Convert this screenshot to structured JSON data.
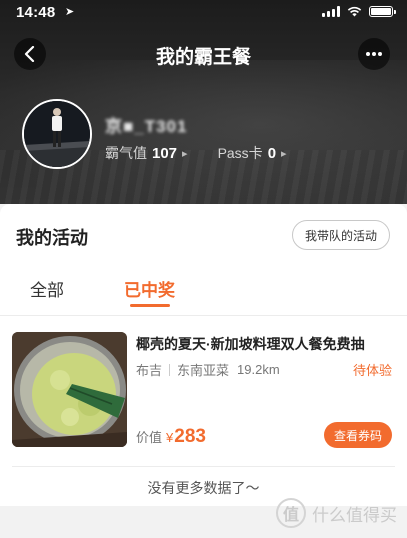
{
  "status_bar": {
    "time": "14:48",
    "location_glyph": "➤"
  },
  "nav": {
    "title": "我的霸王餐",
    "back_icon": "chevron-left-icon",
    "more_icon": "more-dots-icon"
  },
  "profile": {
    "username": "京■_T301",
    "stats": [
      {
        "label": "霸气值",
        "value": "107"
      },
      {
        "label": "Pass卡",
        "value": "0"
      }
    ]
  },
  "activities": {
    "title": "我的活动",
    "team_button": "我带队的活动",
    "tabs": [
      {
        "label": "全部",
        "active": false
      },
      {
        "label": "已中奖",
        "active": true
      }
    ],
    "items": [
      {
        "title": "椰壳的夏天·新加坡料理双人餐免费抽",
        "area": "布吉",
        "cuisine": "东南亚菜",
        "distance": "19.2km",
        "status": "待体验",
        "price_label": "价值",
        "currency": "¥",
        "price": "283",
        "action": "查看券码"
      }
    ],
    "no_more": "没有更多数据了～"
  },
  "watermark": {
    "logo_char": "值",
    "text": "什么值得买"
  },
  "colors": {
    "accent": "#f26b2e",
    "header_bg": "#2a2a2a"
  }
}
